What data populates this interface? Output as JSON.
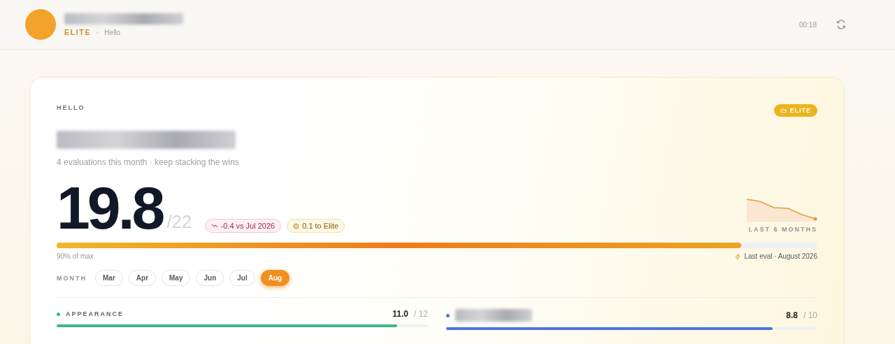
{
  "header": {
    "tier": "ELITE",
    "greeting": "Hello",
    "time": "00:18"
  },
  "card": {
    "eyebrow": "HELLO",
    "badge": "ELITE",
    "subtitle": "4 evaluations this month · keep stacking the wins",
    "score": "19.8",
    "max": "/22",
    "chips": [
      {
        "kind": "trend",
        "text": "-0.4 vs Jul 2026"
      },
      {
        "kind": "target",
        "text": "0.1 to Elite"
      }
    ],
    "trend_label": "LAST 6 MONTHS",
    "progress": {
      "level": 0.9,
      "caption": "90% of max",
      "last_eval": "Last eval · August 2026"
    },
    "month_label": "MONTH",
    "months": [
      {
        "label": "Mar",
        "selected": false
      },
      {
        "label": "Apr",
        "selected": false
      },
      {
        "label": "May",
        "selected": false
      },
      {
        "label": "Jun",
        "selected": false
      },
      {
        "label": "Jul",
        "selected": false
      },
      {
        "label": "Aug",
        "selected": true
      }
    ],
    "categories": [
      {
        "name": "APPEARANCE",
        "score": "11.0",
        "max": "/ 12",
        "level": 0.917,
        "color": "#3fb58a"
      },
      {
        "score": "8.8",
        "max": "/ 10",
        "level": 0.88,
        "color": "#4f74e0"
      }
    ]
  }
}
